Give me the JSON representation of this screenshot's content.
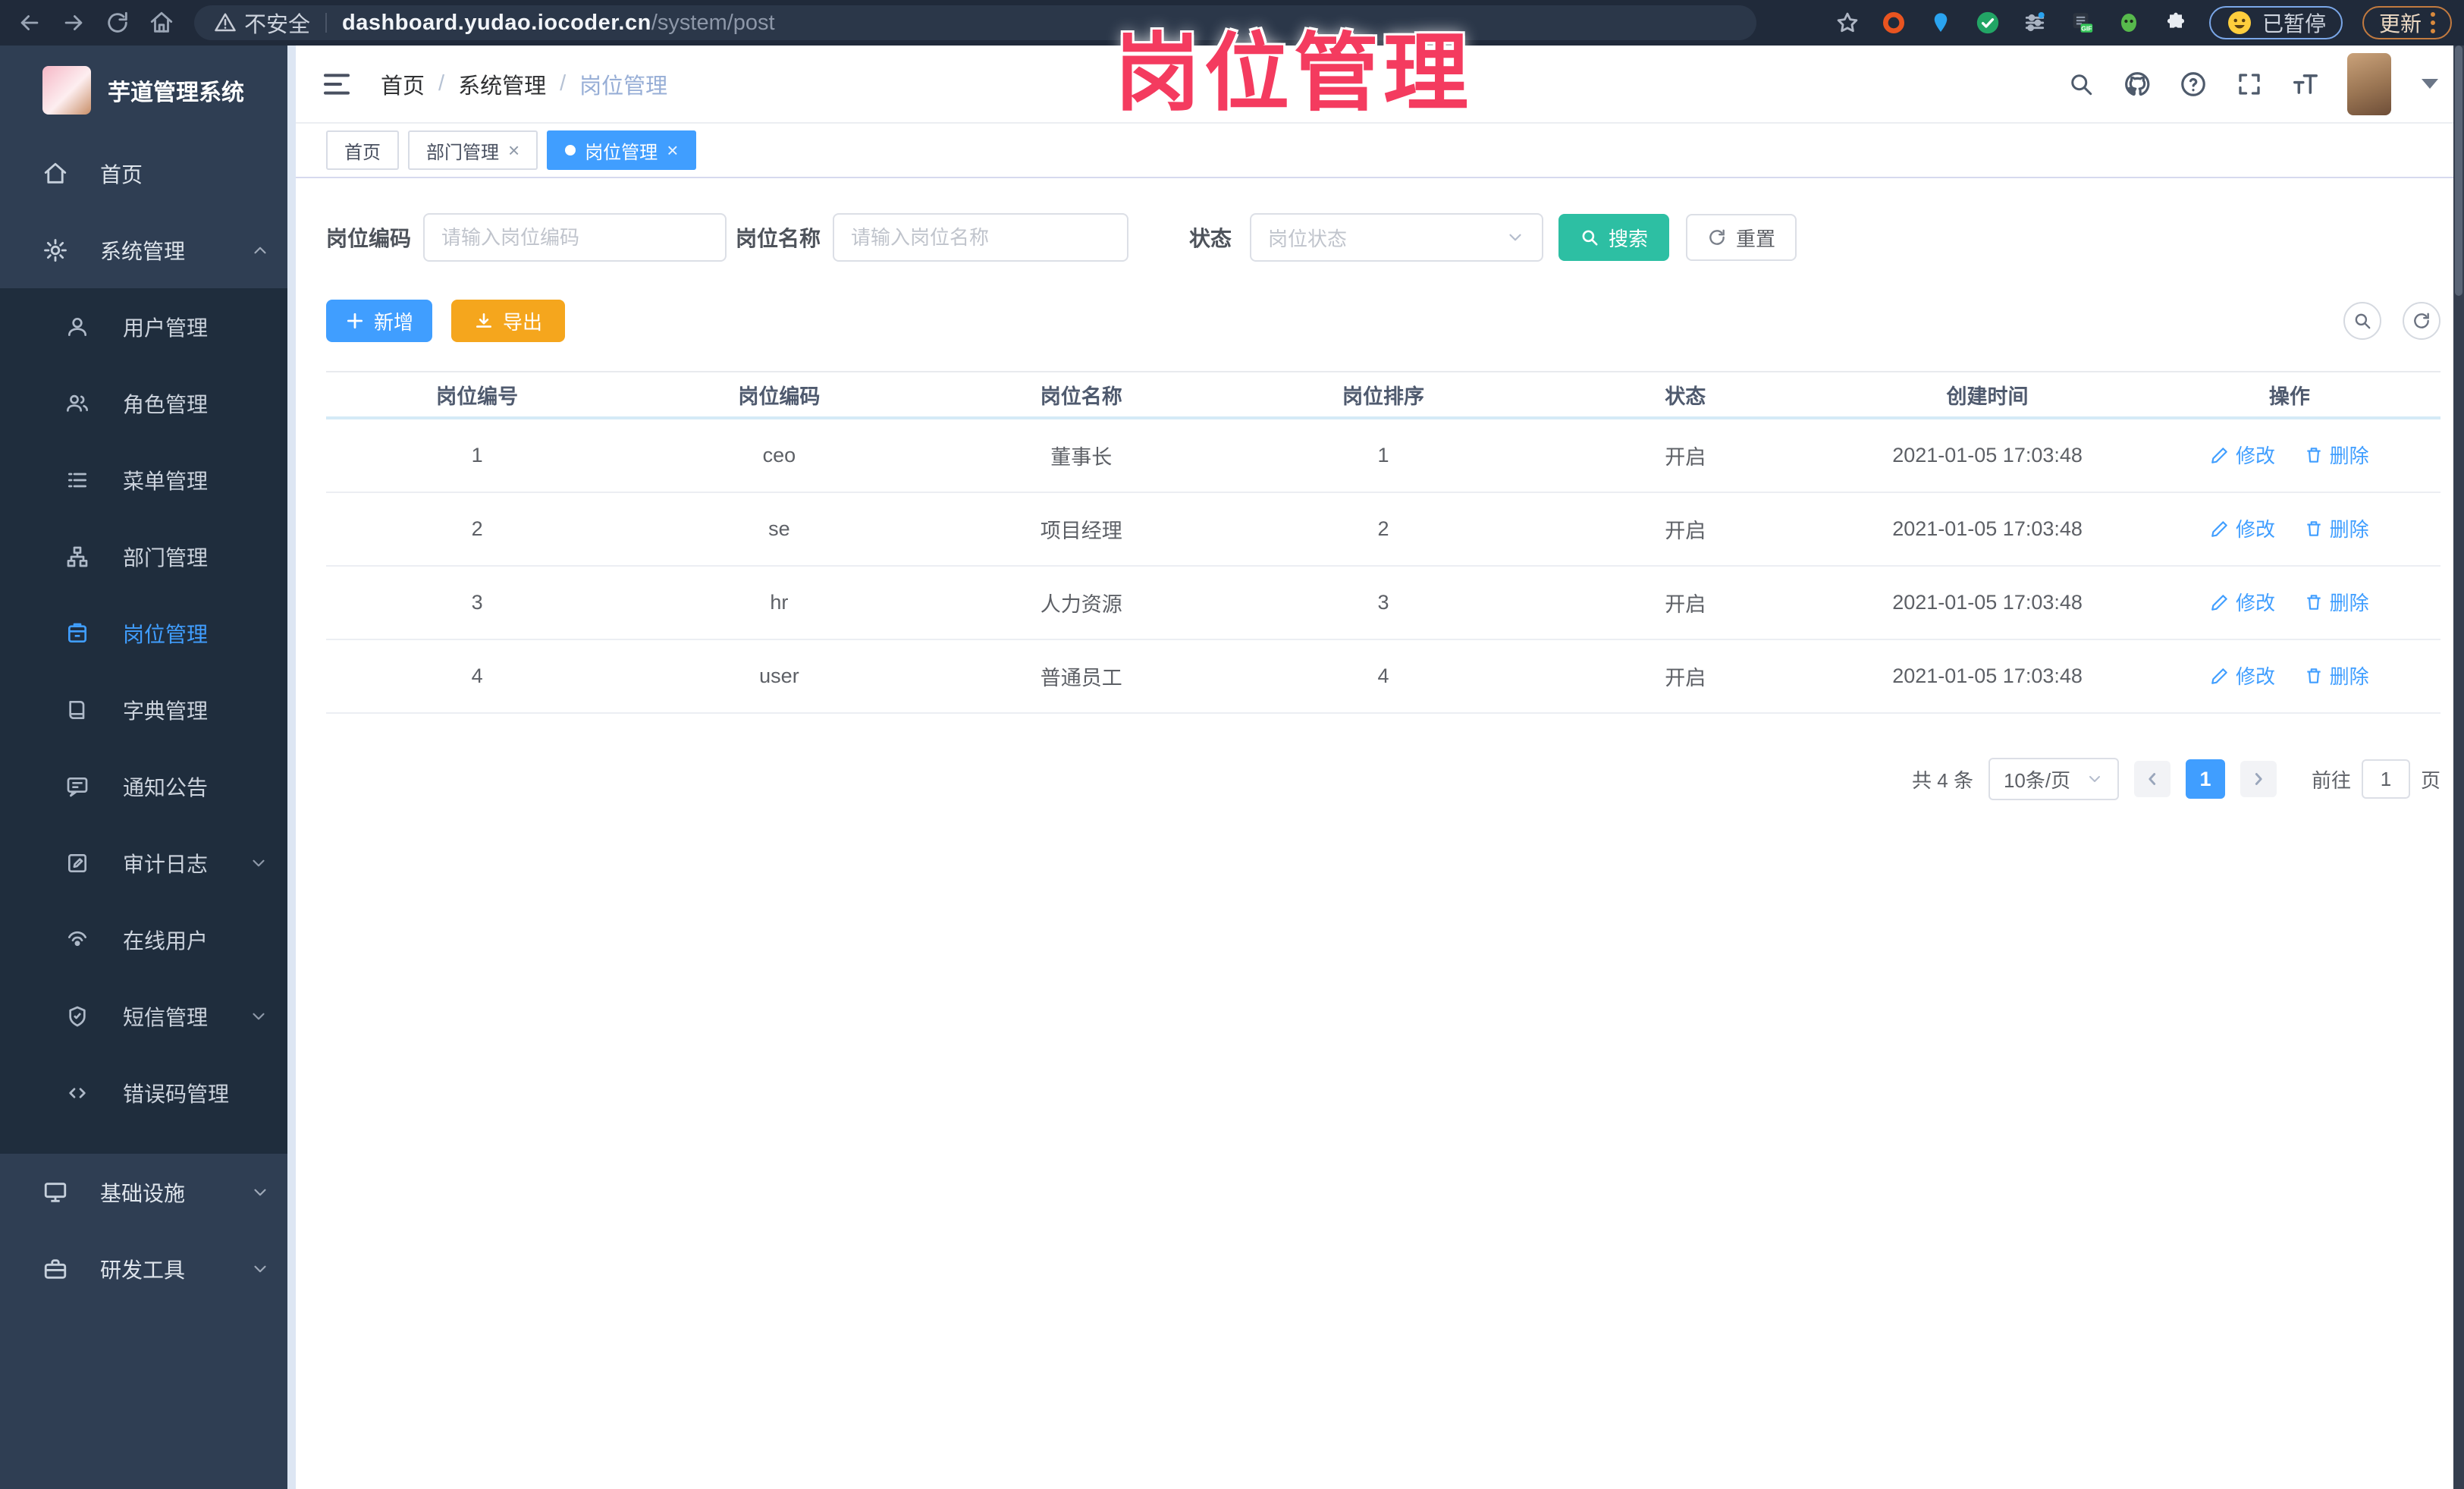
{
  "browser": {
    "security_label": "不安全",
    "url_host": "dashboard.yudao.iocoder.cn",
    "url_path": "/system/post",
    "paused_badge": "已暂停",
    "update_button": "更新"
  },
  "watermark": "岗位管理",
  "sidebar": {
    "app_title": "芋道管理系统",
    "menu": [
      {
        "label": "首页",
        "icon": "home-icon"
      },
      {
        "label": "系统管理",
        "icon": "gear-icon",
        "expanded": true
      }
    ],
    "system_submenu": [
      {
        "label": "用户管理",
        "icon": "user-icon"
      },
      {
        "label": "角色管理",
        "icon": "role-icon"
      },
      {
        "label": "菜单管理",
        "icon": "menu-list-icon"
      },
      {
        "label": "部门管理",
        "icon": "dept-tree-icon"
      },
      {
        "label": "岗位管理",
        "icon": "post-badge-icon",
        "active": true
      },
      {
        "label": "字典管理",
        "icon": "dictionary-icon"
      },
      {
        "label": "通知公告",
        "icon": "announcement-icon"
      },
      {
        "label": "审计日志",
        "icon": "audit-log-icon",
        "has_children": true
      },
      {
        "label": "在线用户",
        "icon": "online-user-icon"
      },
      {
        "label": "短信管理",
        "icon": "sms-shield-icon",
        "has_children": true
      },
      {
        "label": "错误码管理",
        "icon": "error-code-icon"
      }
    ],
    "bottom_menu": [
      {
        "label": "基础设施",
        "icon": "infrastructure-icon",
        "has_children": true
      },
      {
        "label": "研发工具",
        "icon": "dev-tools-icon",
        "has_children": true
      }
    ]
  },
  "header": {
    "separator": "/",
    "breadcrumb": [
      "首页",
      "系统管理",
      "岗位管理"
    ]
  },
  "tabs": [
    {
      "label": "首页",
      "closable": false,
      "active": false
    },
    {
      "label": "部门管理",
      "closable": true,
      "active": false
    },
    {
      "label": "岗位管理",
      "closable": true,
      "active": true
    }
  ],
  "filters": {
    "code_label": "岗位编码",
    "code_placeholder": "请输入岗位编码",
    "name_label": "岗位名称",
    "name_placeholder": "请输入岗位名称",
    "status_label": "状态",
    "status_placeholder": "岗位状态",
    "search_button": "搜索",
    "reset_button": "重置"
  },
  "toolbar": {
    "add_button": "新增",
    "export_button": "导出"
  },
  "table": {
    "columns": [
      "岗位编号",
      "岗位编码",
      "岗位名称",
      "岗位排序",
      "状态",
      "创建时间",
      "操作"
    ],
    "rows": [
      {
        "id": "1",
        "code": "ceo",
        "name": "董事长",
        "sort": "1",
        "status": "开启",
        "created_at": "2021-01-05 17:03:48"
      },
      {
        "id": "2",
        "code": "se",
        "name": "项目经理",
        "sort": "2",
        "status": "开启",
        "created_at": "2021-01-05 17:03:48"
      },
      {
        "id": "3",
        "code": "hr",
        "name": "人力资源",
        "sort": "3",
        "status": "开启",
        "created_at": "2021-01-05 17:03:48"
      },
      {
        "id": "4",
        "code": "user",
        "name": "普通员工",
        "sort": "4",
        "status": "开启",
        "created_at": "2021-01-05 17:03:48"
      }
    ],
    "actions": {
      "edit": "修改",
      "delete": "删除"
    }
  },
  "pagination": {
    "total_text": "共 4 条",
    "page_size": "10条/页",
    "current_page": "1",
    "goto_label": "前往",
    "goto_value": "1",
    "page_unit": "页"
  },
  "colors": {
    "primary": "#409eff",
    "search_teal": "#2dbfa3",
    "export_orange": "#f5a61d",
    "watermark_pink": "#f43b5f",
    "sidebar_bg": "#2f3e53",
    "submenu_bg": "#1f2d3d",
    "chrome_bg": "#202a3a"
  }
}
